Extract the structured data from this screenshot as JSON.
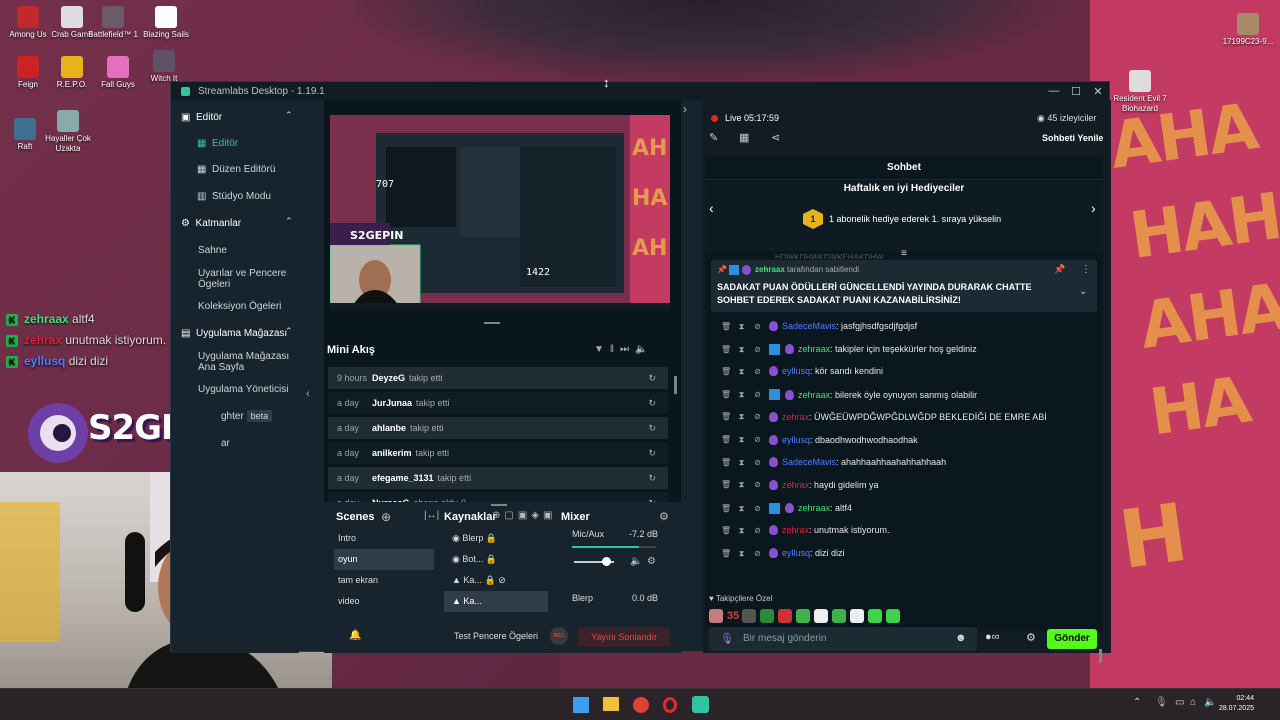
{
  "desktop": {
    "icons": [
      {
        "label": "Among Us"
      },
      {
        "label": "Crab Game"
      },
      {
        "label": "Battlefield™ 1"
      },
      {
        "label": "Blazing Sails"
      },
      {
        "label": "Feign"
      },
      {
        "label": "R.E.P.O."
      },
      {
        "label": "Fall Guys"
      },
      {
        "label": "Witch It"
      },
      {
        "label": "Raft"
      },
      {
        "label": "Hayaller Çok Uzakta"
      },
      {
        "label": "17199C23-9..."
      },
      {
        "label": "Resident Evil 7 Biohazard"
      }
    ]
  },
  "stream_overlay": {
    "chat": [
      {
        "user": "zehraax",
        "text": "altf4",
        "color": "#3fe07a"
      },
      {
        "user": "zehrax",
        "text": "unutmak istiyorum.",
        "color": "#e0203a"
      },
      {
        "user": "eyllusq",
        "text": "dizi dizi",
        "color": "#4f7dff"
      }
    ],
    "logo_text": "S2GEPIN"
  },
  "app": {
    "title": "Streamlabs Desktop - 1.19.1",
    "sidebar": {
      "editor_section": "Editör",
      "editor": "Editör",
      "layout_editor": "Düzen Editörü",
      "studio_mode": "Stüdyo Modu",
      "layers_section": "Katmanlar",
      "scene": "Sahne",
      "widgets": "Uyarılar ve Pencere Ögeleri",
      "collection": "Koleksiyon Ögeleri",
      "store_section": "Uygulama Mağazası",
      "store_home": "Uygulama Mağazası Ana Sayfa",
      "app_managers": "Uygulama Yöneticisi",
      "highlighter": "ghter",
      "beta": "beta",
      "other": "ar"
    },
    "preview_overlay": {
      "logo": "S2GEPIN",
      "counter1": "707",
      "counter2": "1422"
    },
    "mini_feed": {
      "title": "Mini Akış",
      "items": [
        {
          "time": "9 hours",
          "user": "DeyzeG",
          "action": "takip etti"
        },
        {
          "time": "a day",
          "user": "JurJunaa",
          "action": "takip etti"
        },
        {
          "time": "a day",
          "user": "ahlanbe",
          "action": "takip etti"
        },
        {
          "time": "a day",
          "user": "anilkerim",
          "action": "takip etti"
        },
        {
          "time": "a day",
          "user": "efegame_3131",
          "action": "takip etti"
        },
        {
          "time": "a day",
          "user": "NursacG",
          "action": "abone oldu ()"
        }
      ]
    },
    "scenes": {
      "title": "Scenes",
      "items": [
        "Intro",
        "oyun",
        "tam ekran",
        "video"
      ],
      "selected": 1
    },
    "sources": {
      "title": "Kaynaklar",
      "items": [
        "Blerp",
        "Bot...",
        "Ka...",
        "Ka..."
      ]
    },
    "mixer": {
      "title": "Mixer",
      "channels": [
        {
          "name": "Mic/Aux",
          "db": "-7.2 dB",
          "level": 0.8
        },
        {
          "name": "Blerp",
          "db": "0.0 dB"
        }
      ]
    },
    "footer": {
      "test_widgets": "Test Pencere Ögeleri",
      "rec": "REC",
      "end_stream": "Yayını Sonlandır"
    }
  },
  "chat": {
    "live_label": "Live",
    "live_time": "05:17:59",
    "viewers": "45 izleyiciler",
    "refresh": "Sohbeti Yenile",
    "tab_title": "Sohbet",
    "gifters_title": "Haftalık en iyi Hediyeciler",
    "gifters_rank": "1",
    "gifters_text": "1 abonelik hediye ederek 1. sıraya yükselin",
    "hidden_line": "HDWKDHWKDWKEHAKDHW",
    "pinned": {
      "user": "zehraax",
      "by": "tarafından sabitlendi",
      "text": "SADAKAT PUAN ÖDÜLLERİ GÜNCELLENDİ YAYINDA DURARAK CHATTE SOHBET EDEREK SADAKAT PUANI KAZANABİLİRSİNİZ!"
    },
    "messages": [
      {
        "user": "SadeceMavis",
        "text": ": jasfgjhsdfgsdjfgdjsf",
        "color": "#4f7dff",
        "mod": false
      },
      {
        "user": "zehraax",
        "text": ": takipler için teşekkürler hoş geldiniz",
        "color": "#3fe07a",
        "mod": true
      },
      {
        "user": "eyllusq",
        "text": ": kör sandı kendini",
        "color": "#4f7dff",
        "mod": false
      },
      {
        "user": "zehraax",
        "text": ": bilerek öyle oynuyon sanmış olabilir",
        "color": "#3fe07a",
        "mod": true
      },
      {
        "user": "zehrax",
        "text": ": ÜWĞEÜWPDĞWPĞDLWĞDP BEKLEDİĞİ DE EMRE ABİ",
        "color": "#e0203a",
        "mod": false
      },
      {
        "user": "eyllusq",
        "text": ": dbaodhwodhwodhaodhak",
        "color": "#4f7dff",
        "mod": false
      },
      {
        "user": "SadeceMavis",
        "text": ": ahahhaahhaahahhahhaah",
        "color": "#4f7dff",
        "mod": false
      },
      {
        "user": "zehrax",
        "text": ": haydi gidelim ya",
        "color": "#e0203a",
        "mod": false
      },
      {
        "user": "zehraax",
        "text": ": altf4",
        "color": "#3fe07a",
        "mod": true
      },
      {
        "user": "zehrax",
        "text": ": unutmak istiyorum.",
        "color": "#e0203a",
        "mod": false
      },
      {
        "user": "eyllusq",
        "text": ": dizi dizi",
        "color": "#4f7dff",
        "mod": false
      }
    ],
    "follower_only": "Takipçilere Özel",
    "emote_count": "35",
    "input_placeholder": "Bir mesaj gönderin",
    "send": "Gönder"
  },
  "taskbar": {
    "time": "02:44",
    "date": "28.07.2025"
  }
}
